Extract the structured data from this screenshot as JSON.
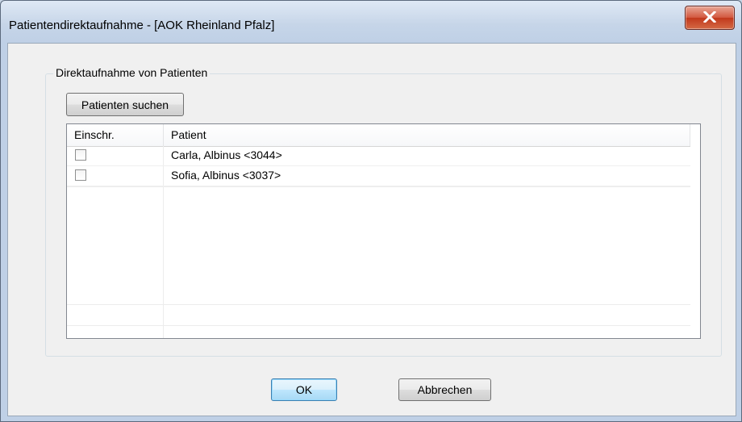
{
  "window": {
    "title": "Patientendirektaufnahme - [AOK Rheinland Pfalz]",
    "close_icon": "close-icon"
  },
  "group": {
    "label": "Direktaufnahme von Patienten",
    "search_button": "Patienten suchen"
  },
  "list": {
    "columns": [
      "Einschr.",
      "Patient"
    ],
    "rows": [
      {
        "checked": false,
        "patient": "Carla, Albinus <3044>"
      },
      {
        "checked": false,
        "patient": "Sofia, Albinus <3037>"
      }
    ]
  },
  "buttons": {
    "ok": "OK",
    "cancel": "Abbrechen"
  },
  "colors": {
    "close_button": "#c7452a",
    "dialog_bg": "#f0f0f0",
    "title_bg": "#c6d5e8"
  }
}
